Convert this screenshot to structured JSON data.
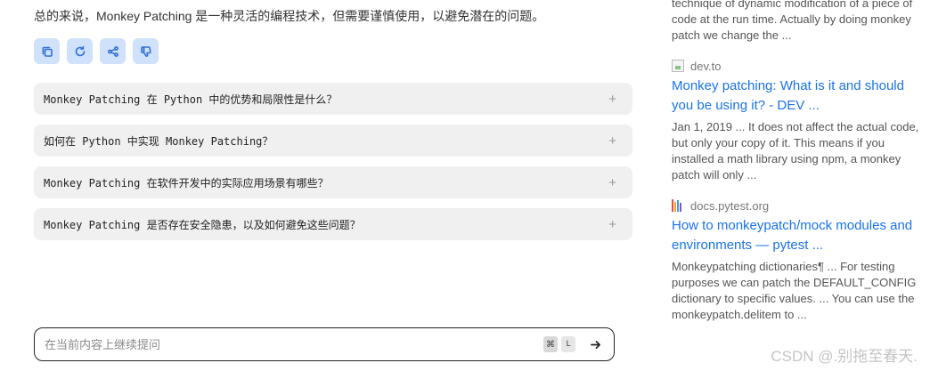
{
  "summary": "总的来说，Monkey Patching 是一种灵活的编程技术，但需要谨慎使用，以避免潜在的问题。",
  "actions": [
    {
      "name": "copy-icon"
    },
    {
      "name": "refresh-icon"
    },
    {
      "name": "share-icon"
    },
    {
      "name": "thumbs-down-icon"
    }
  ],
  "suggestions": [
    {
      "text": "Monkey Patching 在 Python 中的优势和局限性是什么？"
    },
    {
      "text": "如何在 Python 中实现 Monkey Patching？"
    },
    {
      "text": "Monkey Patching 在软件开发中的实际应用场景有哪些？"
    },
    {
      "text": "Monkey Patching 是否存在安全隐患，以及如何避免这些问题？"
    }
  ],
  "plus_symbol": "+",
  "input": {
    "placeholder": "在当前内容上继续提问",
    "kbd_cmd": "⌘",
    "kbd_l": "L"
  },
  "sources": {
    "top_snippet": "technique of dynamic modification of a piece of code at the run time. Actually by doing monkey patch we change the ...",
    "items": [
      {
        "domain": "dev.to",
        "title": "Monkey patching: What is it and should you be using it? - DEV ...",
        "snippet": "Jan 1, 2019 ... It does not affect the actual code, but only your copy of it. This means if you installed a math library using npm, a monkey patch will only ..."
      },
      {
        "domain": "docs.pytest.org",
        "title": "How to monkeypatch/mock modules and environments — pytest ...",
        "snippet": "Monkeypatching dictionaries¶ ... For testing purposes we can patch the DEFAULT_CONFIG dictionary to specific values. ... You can use the monkeypatch.delitem to ..."
      }
    ]
  },
  "watermark": "CSDN @.别拖至春天.",
  "colors": {
    "accent": "#1a73e8",
    "action_bg": "#cfe1fb",
    "suggestion_bg": "#f0f0f0"
  }
}
